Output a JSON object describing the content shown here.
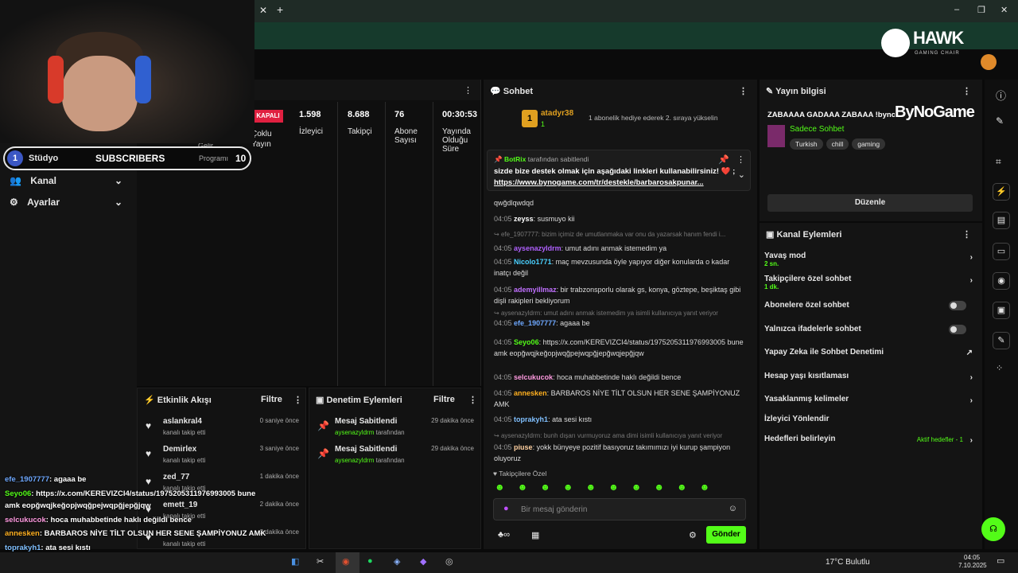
{
  "browser": {
    "new_tab": "+",
    "minimize": "–",
    "restore": "❐",
    "close": "✕"
  },
  "sponsor": {
    "hawk_logo": "HAWK",
    "hawk_sub": "GAMING CHAIR",
    "bynogame": "ByNoGame"
  },
  "overlay_bar": {
    "count1": "1",
    "label1": "Stüdyo",
    "label2": "SUBSCRIBERS",
    "count2": "10"
  },
  "sidebar": {
    "items": [
      {
        "icon": "users-icon",
        "label": "Kanal"
      },
      {
        "icon": "gear-icon",
        "label": "Ayarlar"
      }
    ],
    "partial": "Gelir",
    "partial2": "Programı"
  },
  "stats": {
    "status": "KAPALI",
    "multi_stream": "Çoklu Yayın",
    "items": [
      {
        "value": "1.598",
        "label": "İzleyici"
      },
      {
        "value": "8.688",
        "label": "Takipçi"
      },
      {
        "value": "76",
        "label": "Abone Sayısı"
      },
      {
        "value": "00:30:53",
        "label": "Yayında Olduğu Süre"
      }
    ]
  },
  "activity": {
    "title": "Etkinlik Akışı",
    "filter": "Filtre",
    "items": [
      {
        "name": "aslankral4",
        "sub": "kanalı takip etti",
        "time": "0 saniye önce"
      },
      {
        "name": "Demirlex",
        "sub": "kanalı takip etti",
        "time": "3 saniye önce"
      },
      {
        "name": "zed_77",
        "sub": "kanalı takip etti",
        "time": "1 dakika önce"
      },
      {
        "name": "emett_19",
        "sub": "kanalı takip etti",
        "time": "2 dakika önce"
      },
      {
        "name": "",
        "sub": "kanalı takip etti",
        "time": "2 dakika önce"
      }
    ]
  },
  "moderation": {
    "title": "Denetim Eylemleri",
    "filter": "Filtre",
    "items": [
      {
        "title": "Mesaj Sabitlendi",
        "user": "aysenazyldrm",
        "suffix": "tarafından",
        "time": "29 dakika önce"
      },
      {
        "title": "Mesaj Sabitlendi",
        "user": "aysenazyldrm",
        "suffix": "tarafından",
        "time": "29 dakika önce"
      }
    ]
  },
  "chat": {
    "title": "Sohbet",
    "gift": {
      "rank": "1",
      "user": "atadyr38",
      "count": "1",
      "text": "1 abonelik hediye ederek 2. sıraya yükselin"
    },
    "pinned": {
      "by": "BotRix",
      "by_suffix": "tarafından sabitlendi",
      "text": "sizde bize destek olmak için aşağıdaki linkleri kullanabilirsiniz! ❤️ ;",
      "link": "https://www.bynogame.com/tr/destekle/barbarosakpunar..."
    },
    "messages": [
      {
        "time": "",
        "user": "",
        "text": "qwğdlqwdqd",
        "color": "#ddd"
      },
      {
        "time": "04:05",
        "user": "zeyss",
        "text": ": susmuyo kii",
        "color": "#ffffff"
      },
      {
        "reply": "efe_1907777: bizim içimiz de umutlanmaka var onu da yazarsak hanım fendi i..."
      },
      {
        "time": "04:05",
        "user": "aysenazyldrm",
        "text": ": umut adını anmak istemedim ya",
        "color": "#b060ff"
      },
      {
        "time": "04:05",
        "user": "Nicolo1771",
        "text": ": maç mevzusunda öyle yapıyor diğer konularda o kadar inatçı değil",
        "color": "#4ad0ff"
      },
      {
        "time": "04:05",
        "user": "ademyillmaz",
        "text": ": bir trabzonsporlu olarak gs, konya, göztepe, beşiktaş gibi dişli rakipleri bekliyorum",
        "color": "#c070ff"
      },
      {
        "reply": "aysenazyldrm: umut adını anmak istemedim ya isimli kullanıcıya yanıt veriyor"
      },
      {
        "time": "04:05",
        "user": "efe_1907777",
        "text": ": agaaa be",
        "color": "#6ea8ff"
      },
      {
        "time": "04:05",
        "user": "Seyo06",
        "text": ": https://x.com/KEREVIZCI4/status/1975205311976993005 bune amk eopğwqjkeğopjwqğpejwqpğjepğwqjepğjqw",
        "color": "#53fc18"
      },
      {
        "time": "04:05",
        "user": "selcukucok",
        "text": ": hoca muhabbetinde haklı değildi bence",
        "color": "#ff9ae0"
      },
      {
        "time": "04:05",
        "user": "annesken",
        "text": ": BARBAROS NİYE TİLT OLSUN HER SENE ŞAMPİYONUZ AMK",
        "color": "#ffb020"
      },
      {
        "time": "04:05",
        "user": "toprakyh1",
        "text": ": ata sesi kıstı",
        "color": "#80c0ff"
      },
      {
        "reply": "aysenazyldrm: bunh dışarı vurmuyoruz ama dimi isimli kullanıcıya yanıt veriyor"
      },
      {
        "time": "04:05",
        "user": "piuse",
        "text": ": yokk bünyeye pozitif basıyoruz takımımızı iyi kurup şampiyon oluyoruz",
        "color": "#ffd0a0"
      }
    ],
    "followers_only": "Takipçilere Özel",
    "input_placeholder": "Bir mesaj gönderin",
    "send": "Gönder"
  },
  "stream_info": {
    "title_label": "Yayın bilgisi",
    "stream_title": "ZABAAAA GADAAA ZABAAA !bynogame !kast",
    "category": "Sadece Sohbet",
    "tags": [
      "Turkish",
      "chill",
      "gaming"
    ],
    "edit": "Düzenle"
  },
  "channel_actions": {
    "title": "Kanal Eylemleri",
    "items": [
      {
        "label": "Yavaş mod",
        "sub": "2 sn.",
        "kind": "arrow"
      },
      {
        "label": "Takipçilere özel sohbet",
        "sub": "1 dk.",
        "kind": "arrow"
      },
      {
        "label": "Abonelere özel sohbet",
        "sub": "",
        "kind": "toggle"
      },
      {
        "label": "Yalnızca ifadelerle sohbet",
        "sub": "",
        "kind": "toggle"
      },
      {
        "label": "Yapay Zeka ile Sohbet Denetimi",
        "sub": "",
        "kind": "external"
      },
      {
        "label": "Hesap yaşı kısıtlaması",
        "sub": "",
        "kind": "arrow"
      },
      {
        "label": "Yasaklanmış kelimeler",
        "sub": "",
        "kind": "arrow"
      },
      {
        "label": "İzleyici Yönlendir",
        "sub": "",
        "kind": "none"
      },
      {
        "label": "Hedefleri belirleyin",
        "sub": "",
        "kind": "arrow"
      }
    ],
    "goals_status": "Aktif hedefler - 1"
  },
  "overlay_chat": [
    {
      "user": "efe_1907777",
      "text": ": agaaa be",
      "color": "#6ea8ff"
    },
    {
      "user": "Seyo06",
      "text": ": https://x.com/KEREVIZCI4/status/1975205311976993005 bune",
      "color": "#53fc18"
    },
    {
      "user": "",
      "text": "amk eopğwqjkeğopjwqğpejwqpğjepğjqw",
      "color": "#fff"
    },
    {
      "user": "selcukucok",
      "text": ": hoca muhabbetinde haklı değildi bence",
      "color": "#ff9ae0"
    },
    {
      "user": "annesken",
      "text": ": BARBAROS NİYE TİLT OLSUN HER SENE ŞAMPİYONUZ AMK",
      "color": "#ffb020"
    },
    {
      "user": "toprakyh1",
      "text": ": ata sesi kıstı",
      "color": "#80c0ff"
    },
    {
      "user": "piuse",
      "text": ": yokk bünyeye pozitif basıyoruz takımımızı iyi kurup şampiyon oluyoruz",
      "color": "#ffd0a0"
    }
  ],
  "taskbar": {
    "weather": "17°C  Bulutlu",
    "time": "04:05",
    "date": "7.10.2025"
  }
}
